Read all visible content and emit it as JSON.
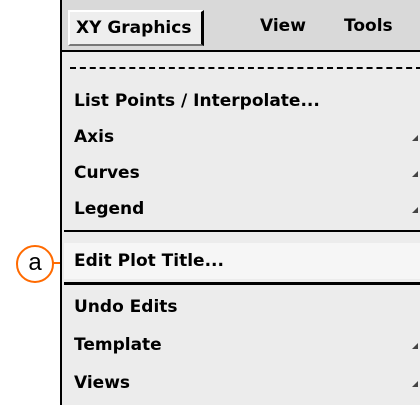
{
  "menubar": {
    "tabs": [
      {
        "label": "XY Graphics"
      },
      {
        "label": "View"
      },
      {
        "label": "Tools"
      }
    ]
  },
  "menu": {
    "items": [
      {
        "label": "List Points / Interpolate...",
        "submenu": false
      },
      {
        "label": "Axis",
        "submenu": true
      },
      {
        "label": "Curves",
        "submenu": true
      },
      {
        "label": "Legend",
        "submenu": true
      },
      {
        "label": "Edit Plot Title...",
        "submenu": false
      },
      {
        "label": "Undo Edits",
        "submenu": false
      },
      {
        "label": "Template",
        "submenu": true
      },
      {
        "label": "Views",
        "submenu": true
      }
    ]
  },
  "callout": {
    "label": "a",
    "color": "#ff6a00"
  }
}
